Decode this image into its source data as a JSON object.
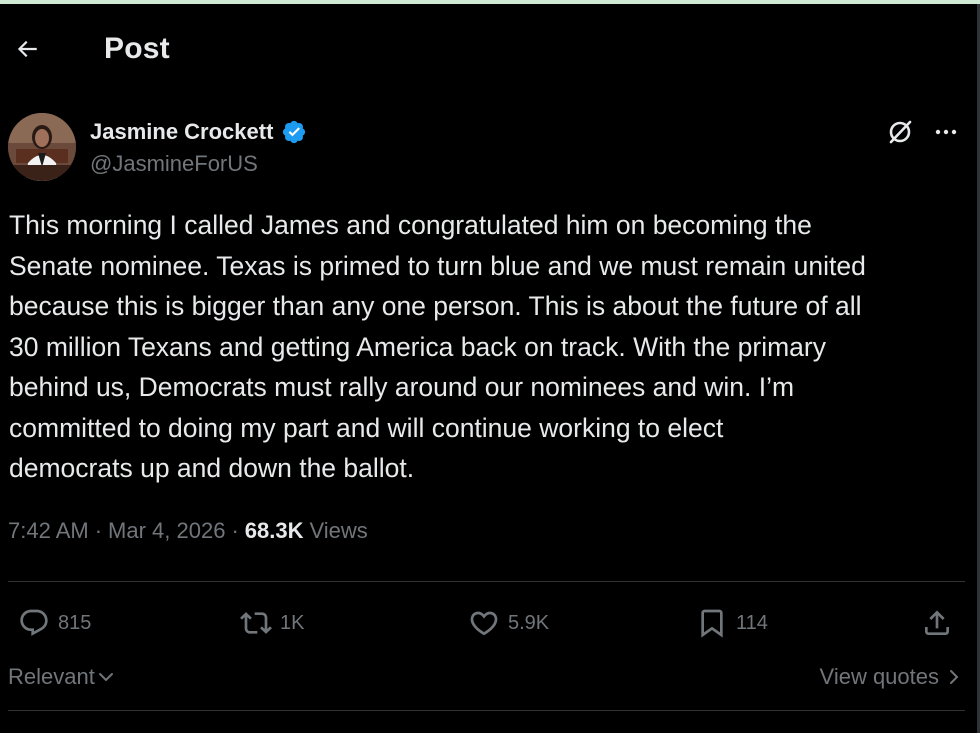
{
  "header": {
    "title": "Post",
    "back_icon": "back-arrow-icon"
  },
  "author": {
    "name": "Jasmine Crockett",
    "handle": "@JasmineForUS",
    "verified": true,
    "verified_color": "#1d9bf0"
  },
  "post": {
    "text": "This morning I called James and congratulated him on becoming the\nSenate nominee. Texas is primed to turn blue and we must remain united\nbecause this is bigger than any one person. This is about the future of all\n30 million Texans and getting America back on track. With the primary\nbehind us, Democrats must rally around our nominees and win. I’m\ncommitted to doing my part and will continue working to elect\ndemocrats up and down the ballot.",
    "time": "7:42 AM",
    "separator": "·",
    "date": "Mar 4, 2026",
    "views_count": "68.3K",
    "views_label": "Views"
  },
  "actions": {
    "replies": "815",
    "reposts": "1K",
    "likes": "5.9K",
    "bookmarks": "114"
  },
  "sort": {
    "relevant_label": "Relevant",
    "view_quotes_label": "View quotes"
  },
  "colors": {
    "background": "#000000",
    "text_primary": "#e7e9ea",
    "text_secondary": "#71767b",
    "divider": "#2f3336",
    "top_strip": "#cfe9d4"
  }
}
